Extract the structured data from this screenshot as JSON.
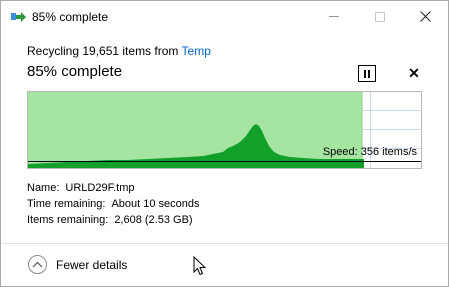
{
  "window": {
    "title": "85% complete",
    "icon": "move-copy-icon"
  },
  "header": {
    "recycling_prefix": "Recycling 19,651 items from",
    "source_link": "Temp",
    "percent_title": "85% complete",
    "progress_fraction": 0.85
  },
  "chart": {
    "speed_label": "Speed: 356 items/s",
    "fill_color": "#a6e5a1",
    "graph_color": "#0d9b24"
  },
  "details": {
    "name_label": "Name:",
    "name_value": "URLD29F.tmp",
    "time_label": "Time remaining:",
    "time_value": "About 10 seconds",
    "items_label": "Items remaining:",
    "items_value": "2,608 (2.53 GB)"
  },
  "footer": {
    "fewer_details": "Fewer details",
    "fewer_icon": "chevron-up-icon"
  }
}
